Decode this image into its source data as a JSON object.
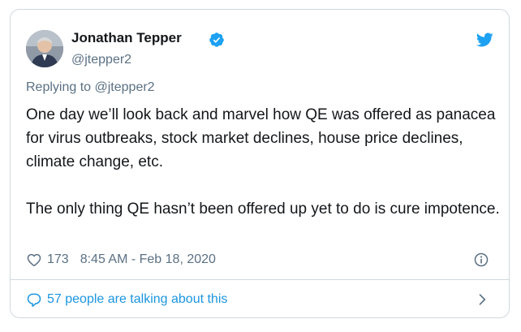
{
  "user": {
    "display_name": "Jonathan Tepper",
    "handle": "@jtepper2",
    "verified": true
  },
  "reply": {
    "prefix": "Replying to ",
    "to_handle": "@jtepper2"
  },
  "tweet": {
    "paragraphs": [
      "One day we’ll look back and marvel how QE was offered as panacea for virus outbreaks, stock market declines, house price declines, climate change, etc.",
      "The only thing QE hasn’t been offered up yet to do is cure impotence."
    ]
  },
  "meta": {
    "like_count": "173",
    "timestamp": "8:45 AM - Feb 18, 2020"
  },
  "conversation": {
    "label": "57 people are talking about this"
  },
  "icons": {
    "verified": "verified-badge-icon",
    "brand": "twitter-bird-icon",
    "like": "heart-icon",
    "info": "info-icon",
    "conversation": "speech-bubble-icon",
    "chevron": "chevron-right-icon"
  },
  "colors": {
    "brand_blue": "#1da1f2",
    "link_blue": "#1b95e0",
    "secondary_text": "#5b7083",
    "border": "#cfd9de"
  }
}
